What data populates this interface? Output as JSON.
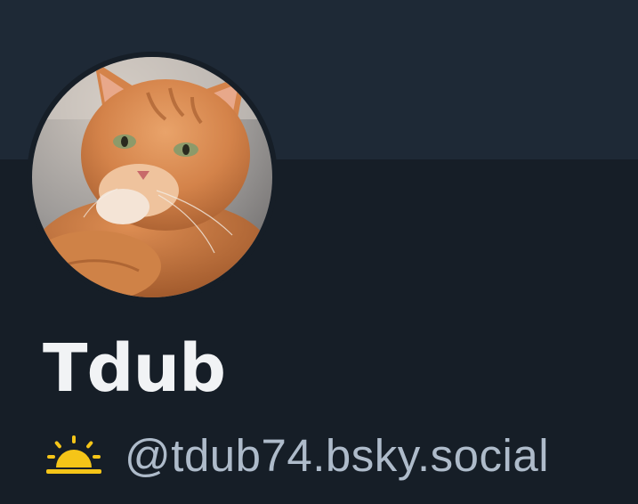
{
  "profile": {
    "display_name": "Tdub",
    "handle": "@tdub74.bsky.social",
    "status_icon": "sunrise-icon",
    "avatar_icon": "orange-cat-photo"
  },
  "colors": {
    "background": "#161e27",
    "banner": "#1e2936",
    "name_text": "#f1f3f5",
    "handle_text": "#aebbca",
    "sun_accent": "#f5c518"
  }
}
